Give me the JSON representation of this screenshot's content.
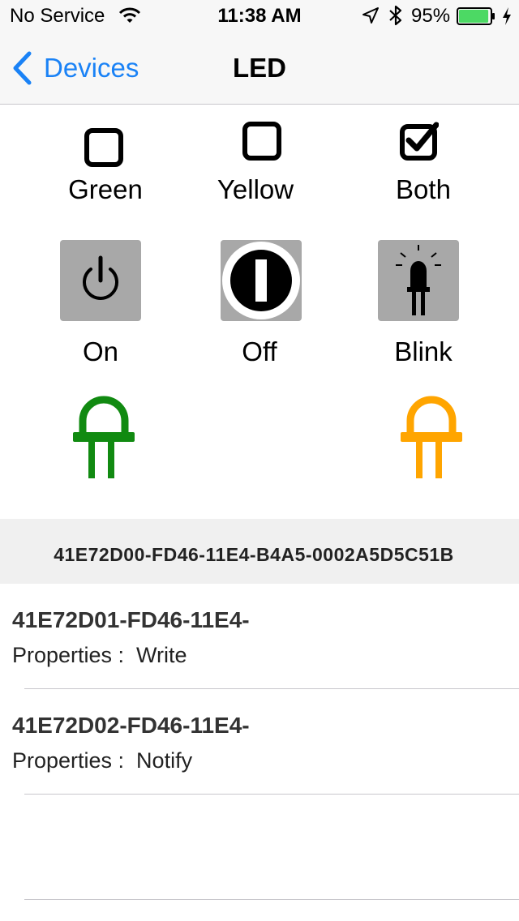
{
  "status_bar": {
    "carrier": "No Service",
    "time": "11:38 AM",
    "battery_percent": "95%",
    "battery_level": 0.95,
    "icons": [
      "wifi-icon",
      "location-arrow-icon",
      "bluetooth-icon",
      "battery-icon",
      "charging-bolt-icon"
    ]
  },
  "nav": {
    "back_label": "Devices",
    "title": "LED"
  },
  "checkboxes": [
    {
      "label": "Green",
      "checked": false
    },
    {
      "label": "Yellow",
      "checked": false
    },
    {
      "label": "Both",
      "checked": true
    }
  ],
  "buttons": [
    {
      "label": "On",
      "icon": "power-icon"
    },
    {
      "label": "Off",
      "icon": "off-switch-icon"
    },
    {
      "label": "Blink",
      "icon": "blinking-led-icon"
    }
  ],
  "leds": [
    {
      "name": "green-led",
      "color": "#118a11"
    },
    {
      "name": "yellow-led",
      "color": "#ffa500"
    }
  ],
  "colors": {
    "accent": "#1a82f6",
    "nav_background": "#f7f7f7",
    "section_background": "#f0f0f0",
    "battery_green": "#4cd964"
  },
  "service": {
    "uuid": "41E72D00-FD46-11E4-B4A5-0002A5D5C51B"
  },
  "characteristics": [
    {
      "uuid": "41E72D01-FD46-11E4-",
      "properties": "Properties :  Write"
    },
    {
      "uuid": "41E72D02-FD46-11E4-",
      "properties": "Properties :  Notify"
    }
  ]
}
